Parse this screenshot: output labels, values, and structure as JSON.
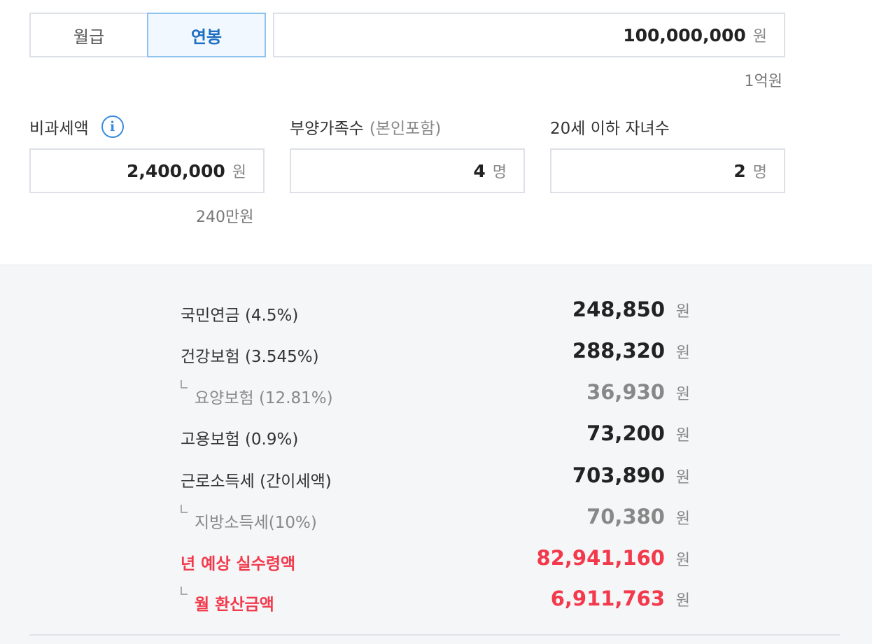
{
  "pay_type": {
    "monthly_label": "월급",
    "annual_label": "연봉",
    "selected": "annual"
  },
  "salary": {
    "value": "100,000,000",
    "unit": "원",
    "hint": "1억원"
  },
  "nontaxable": {
    "label": "비과세액",
    "info_icon": "i",
    "value": "2,400,000",
    "unit": "원",
    "hint": "240만원"
  },
  "dependents": {
    "label": "부양가족수",
    "sublabel": "(본인포함)",
    "value": "4",
    "unit": "명"
  },
  "children": {
    "label": "20세 이하 자녀수",
    "value": "2",
    "unit": "명"
  },
  "results": [
    {
      "label": "국민연금 (4.5%)",
      "value": "248,850",
      "unit": "원",
      "style": "main"
    },
    {
      "label": "건강보험 (3.545%)",
      "value": "288,320",
      "unit": "원",
      "style": "main"
    },
    {
      "label": "요양보험 (12.81%)",
      "value": "36,930",
      "unit": "원",
      "style": "sub"
    },
    {
      "label": "고용보험 (0.9%)",
      "value": "73,200",
      "unit": "원",
      "style": "main"
    },
    {
      "label": "근로소득세 (간이세액)",
      "value": "703,890",
      "unit": "원",
      "style": "main"
    },
    {
      "label": "지방소득세(10%)",
      "value": "70,380",
      "unit": "원",
      "style": "sub"
    },
    {
      "label": "년 예상 실수령액",
      "value": "82,941,160",
      "unit": "원",
      "style": "total"
    },
    {
      "label": "월 환산금액",
      "value": "6,911,763",
      "unit": "원",
      "style": "total-sub"
    }
  ],
  "colors": {
    "accent": "#1f6fc1",
    "highlight": "#f23a4c",
    "muted": "#888888"
  }
}
